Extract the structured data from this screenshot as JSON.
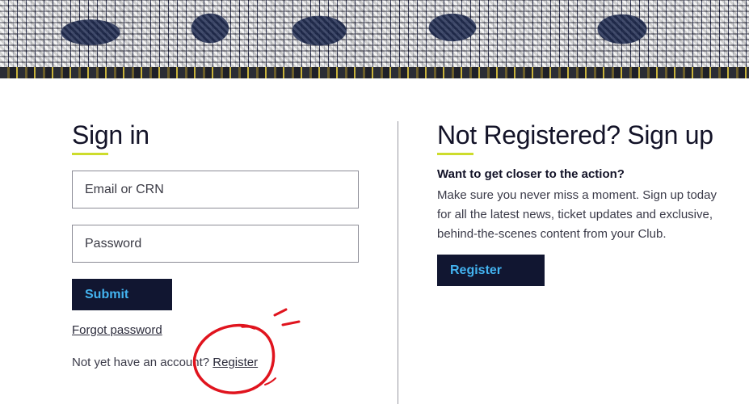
{
  "signin": {
    "heading": "Sign in",
    "email_placeholder": "Email or CRN",
    "password_placeholder": "Password",
    "submit_label": "Submit",
    "forgot_password": "Forgot password",
    "no_account_text": "Not yet have an account? ",
    "register_link": "Register"
  },
  "signup": {
    "heading": "Not Registered? Sign up",
    "subheading": "Want to get closer to the action?",
    "body": "Make sure you never miss a moment. Sign up today for all the latest news, ticket updates and exclusive, behind-the-scenes content from your Club.",
    "register_label": "Register"
  },
  "colors": {
    "accent_underline": "#cddc2c",
    "button_bg": "#111631",
    "button_text": "#43b3f0",
    "annotation_red": "#e0141e"
  },
  "icons": {
    "annotation": "red-hand-drawn-circle"
  }
}
